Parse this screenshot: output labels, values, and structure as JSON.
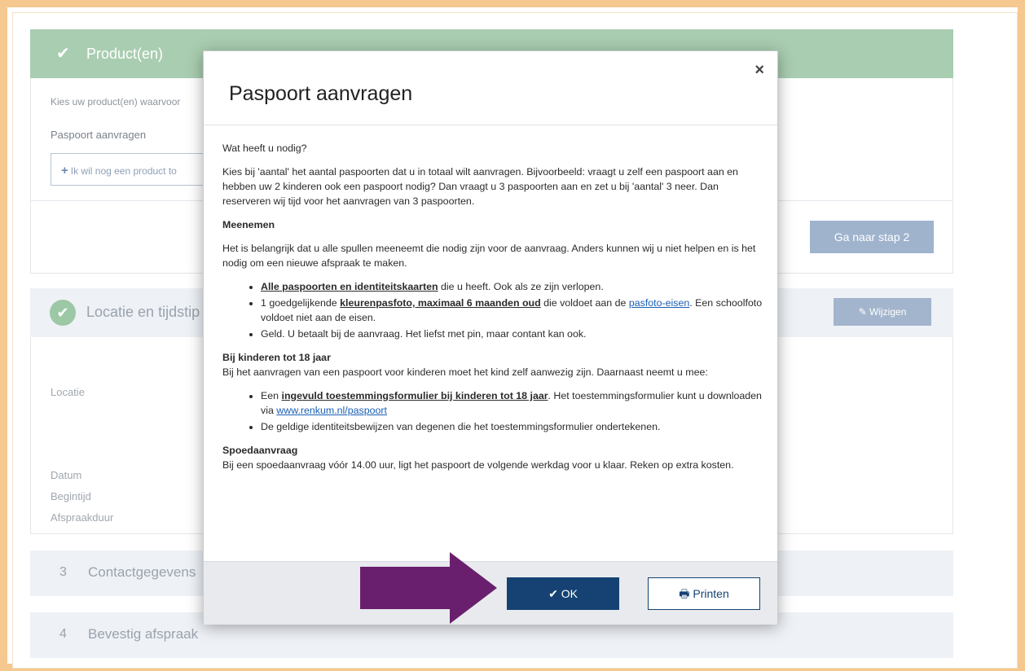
{
  "background": {
    "step1": {
      "title": "Product(en)",
      "intro": "Kies uw product(en) waarvoor",
      "product_name": "Paspoort aanvragen",
      "add_product_label": "Ik wil nog een product to",
      "next_button": "Ga naar stap 2"
    },
    "step2": {
      "title": "Locatie en tijdstip",
      "edit_button": "Wijzigen",
      "labels": {
        "locatie": "Locatie",
        "datum": "Datum",
        "begintijd": "Begintijd",
        "afspraakduur": "Afspraakduur"
      }
    },
    "step3": {
      "number": "3",
      "title": "Contactgegevens"
    },
    "step4": {
      "number": "4",
      "title": "Bevestig afspraak"
    }
  },
  "modal": {
    "title": "Paspoort aanvragen",
    "close": "×",
    "question": "Wat heeft u nodig?",
    "intro": "Kies bij 'aantal' het aantal paspoorten dat u in totaal wilt aanvragen. Bijvoorbeeld: vraagt u zelf een paspoort aan en hebben uw 2 kinderen ook een paspoort nodig? Dan vraagt u 3 paspoorten aan en zet u bij 'aantal' 3 neer. Dan reserveren wij tijd voor het aanvragen van 3 paspoorten.",
    "meenemen_heading": "Meenemen",
    "meenemen_text": "Het is belangrijk dat u alle spullen meeneemt die nodig zijn voor de aanvraag. Anders kunnen wij u niet helpen en is het nodig om een nieuwe afspraak te maken.",
    "item1_bold": "Alle paspoorten en identiteitskaarten",
    "item1_rest": " die u heeft. Ook als ze zijn verlopen.",
    "item2_pre": "1 goedgelijkende ",
    "item2_bold": "kleurenpasfoto, maximaal 6 maanden oud",
    "item2_mid": " die voldoet aan de ",
    "item2_link": "pasfoto-eisen",
    "item2_post": ". Een schoolfoto voldoet niet aan de eisen.",
    "item3": "Geld. U betaalt bij de aanvraag. Het liefst met pin, maar contant kan ook.",
    "kinderen_heading": "Bij kinderen tot 18 jaar",
    "kinderen_text": "Bij het aanvragen van een paspoort voor kinderen moet het kind zelf aanwezig zijn. Daarnaast neemt u mee:",
    "kitem1_pre": "Een ",
    "kitem1_bold": "ingevuld toestemmingsformulier bij kinderen tot 18 jaar",
    "kitem1_mid": ". Het toestemmingsformulier kunt u downloaden via ",
    "kitem1_link": "www.renkum.nl/paspoort",
    "kitem2": "De geldige identiteitsbewijzen van degenen die het toestemmingsformulier ondertekenen.",
    "spoed_heading": "Spoedaanvraag",
    "spoed_text": "Bij een spoedaanvraag vóór 14.00 uur, ligt het paspoort de volgende werkdag voor u klaar. Reken op extra kosten.",
    "ok_label": "OK",
    "print_label": "Printen"
  },
  "colors": {
    "accent": "#154273",
    "arrow": "#6a1f6e",
    "frame": "#f5c88f",
    "step_done": "#a9cdb0"
  }
}
